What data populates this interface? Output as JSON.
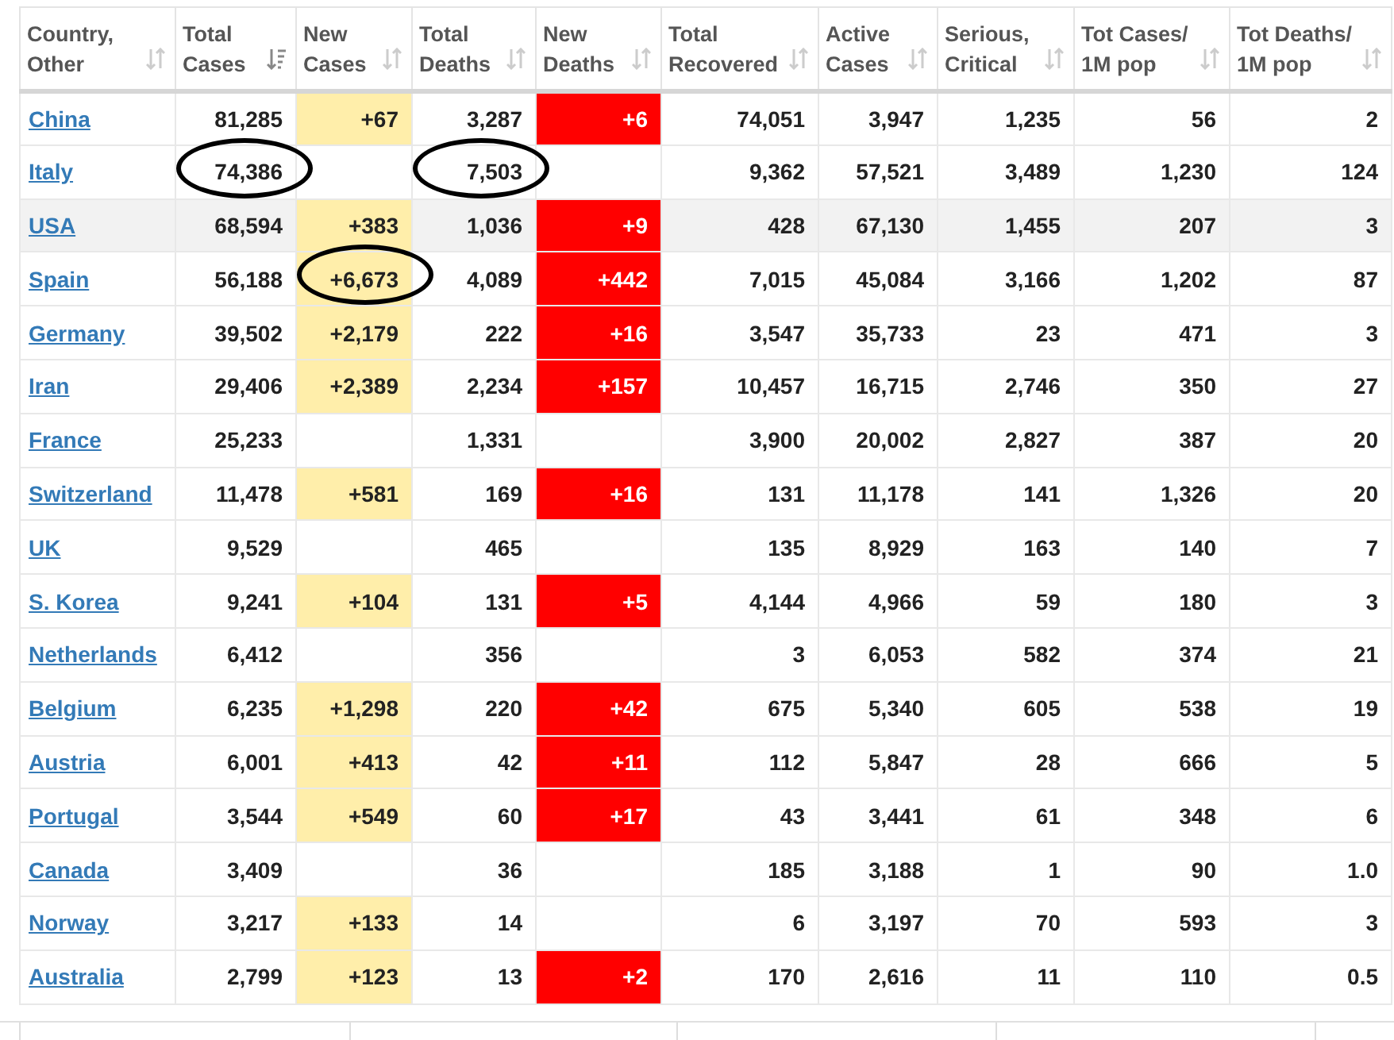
{
  "columns": [
    {
      "label": "Country,\nOther",
      "sorted": false
    },
    {
      "label": "Total\nCases",
      "sorted": true
    },
    {
      "label": "New\nCases",
      "sorted": false
    },
    {
      "label": "Total\nDeaths",
      "sorted": false
    },
    {
      "label": "New\nDeaths",
      "sorted": false
    },
    {
      "label": "Total\nRecovered",
      "sorted": false
    },
    {
      "label": "Active\nCases",
      "sorted": false
    },
    {
      "label": "Serious,\nCritical",
      "sorted": false
    },
    {
      "label": "Tot Cases/\n1M pop",
      "sorted": false
    },
    {
      "label": "Tot Deaths/\n1M pop",
      "sorted": false
    }
  ],
  "rows": [
    {
      "country": "China",
      "total_cases": "81,285",
      "new_cases": "+67",
      "total_deaths": "3,287",
      "new_deaths": "+6",
      "total_recovered": "74,051",
      "active_cases": "3,947",
      "serious_critical": "1,235",
      "tot_cases_1m": "56",
      "tot_deaths_1m": "2",
      "highlighted": false
    },
    {
      "country": "Italy",
      "total_cases": "74,386",
      "total_deaths": "7,503",
      "total_recovered": "9,362",
      "active_cases": "57,521",
      "serious_critical": "3,489",
      "tot_cases_1m": "1,230",
      "tot_deaths_1m": "124",
      "highlighted": false,
      "circled": {
        "total_cases": true,
        "total_deaths": true
      }
    },
    {
      "country": "USA",
      "total_cases": "68,594",
      "new_cases": "+383",
      "total_deaths": "1,036",
      "new_deaths": "+9",
      "total_recovered": "428",
      "active_cases": "67,130",
      "serious_critical": "1,455",
      "tot_cases_1m": "207",
      "tot_deaths_1m": "3",
      "highlighted": true
    },
    {
      "country": "Spain",
      "total_cases": "56,188",
      "new_cases": "+6,673",
      "total_deaths": "4,089",
      "new_deaths": "+442",
      "total_recovered": "7,015",
      "active_cases": "45,084",
      "serious_critical": "3,166",
      "tot_cases_1m": "1,202",
      "tot_deaths_1m": "87",
      "highlighted": false,
      "circled": {
        "new_cases": true
      }
    },
    {
      "country": "Germany",
      "total_cases": "39,502",
      "new_cases": "+2,179",
      "total_deaths": "222",
      "new_deaths": "+16",
      "total_recovered": "3,547",
      "active_cases": "35,733",
      "serious_critical": "23",
      "tot_cases_1m": "471",
      "tot_deaths_1m": "3",
      "highlighted": false
    },
    {
      "country": "Iran",
      "total_cases": "29,406",
      "new_cases": "+2,389",
      "total_deaths": "2,234",
      "new_deaths": "+157",
      "total_recovered": "10,457",
      "active_cases": "16,715",
      "serious_critical": "2,746",
      "tot_cases_1m": "350",
      "tot_deaths_1m": "27",
      "highlighted": false
    },
    {
      "country": "France",
      "total_cases": "25,233",
      "total_deaths": "1,331",
      "total_recovered": "3,900",
      "active_cases": "20,002",
      "serious_critical": "2,827",
      "tot_cases_1m": "387",
      "tot_deaths_1m": "20",
      "highlighted": false
    },
    {
      "country": "Switzerland",
      "total_cases": "11,478",
      "new_cases": "+581",
      "total_deaths": "169",
      "new_deaths": "+16",
      "total_recovered": "131",
      "active_cases": "11,178",
      "serious_critical": "141",
      "tot_cases_1m": "1,326",
      "tot_deaths_1m": "20",
      "highlighted": false
    },
    {
      "country": "UK",
      "total_cases": "9,529",
      "total_deaths": "465",
      "total_recovered": "135",
      "active_cases": "8,929",
      "serious_critical": "163",
      "tot_cases_1m": "140",
      "tot_deaths_1m": "7",
      "highlighted": false
    },
    {
      "country": "S. Korea",
      "total_cases": "9,241",
      "new_cases": "+104",
      "total_deaths": "131",
      "new_deaths": "+5",
      "total_recovered": "4,144",
      "active_cases": "4,966",
      "serious_critical": "59",
      "tot_cases_1m": "180",
      "tot_deaths_1m": "3",
      "highlighted": false
    },
    {
      "country": "Netherlands",
      "total_cases": "6,412",
      "total_deaths": "356",
      "total_recovered": "3",
      "active_cases": "6,053",
      "serious_critical": "582",
      "tot_cases_1m": "374",
      "tot_deaths_1m": "21",
      "highlighted": false
    },
    {
      "country": "Belgium",
      "total_cases": "6,235",
      "new_cases": "+1,298",
      "total_deaths": "220",
      "new_deaths": "+42",
      "total_recovered": "675",
      "active_cases": "5,340",
      "serious_critical": "605",
      "tot_cases_1m": "538",
      "tot_deaths_1m": "19",
      "highlighted": false
    },
    {
      "country": "Austria",
      "total_cases": "6,001",
      "new_cases": "+413",
      "total_deaths": "42",
      "new_deaths": "+11",
      "total_recovered": "112",
      "active_cases": "5,847",
      "serious_critical": "28",
      "tot_cases_1m": "666",
      "tot_deaths_1m": "5",
      "highlighted": false
    },
    {
      "country": "Portugal",
      "total_cases": "3,544",
      "new_cases": "+549",
      "total_deaths": "60",
      "new_deaths": "+17",
      "total_recovered": "43",
      "active_cases": "3,441",
      "serious_critical": "61",
      "tot_cases_1m": "348",
      "tot_deaths_1m": "6",
      "highlighted": false
    },
    {
      "country": "Canada",
      "total_cases": "3,409",
      "total_deaths": "36",
      "total_recovered": "185",
      "active_cases": "3,188",
      "serious_critical": "1",
      "tot_cases_1m": "90",
      "tot_deaths_1m": "1.0",
      "highlighted": false
    },
    {
      "country": "Norway",
      "total_cases": "3,217",
      "new_cases": "+133",
      "total_deaths": "14",
      "total_recovered": "6",
      "active_cases": "3,197",
      "serious_critical": "70",
      "tot_cases_1m": "593",
      "tot_deaths_1m": "3",
      "highlighted": false
    },
    {
      "country": "Australia",
      "total_cases": "2,799",
      "new_cases": "+123",
      "total_deaths": "13",
      "new_deaths": "+2",
      "total_recovered": "170",
      "active_cases": "2,616",
      "serious_critical": "11",
      "tot_cases_1m": "110",
      "tot_deaths_1m": "0.5",
      "highlighted": false
    }
  ]
}
